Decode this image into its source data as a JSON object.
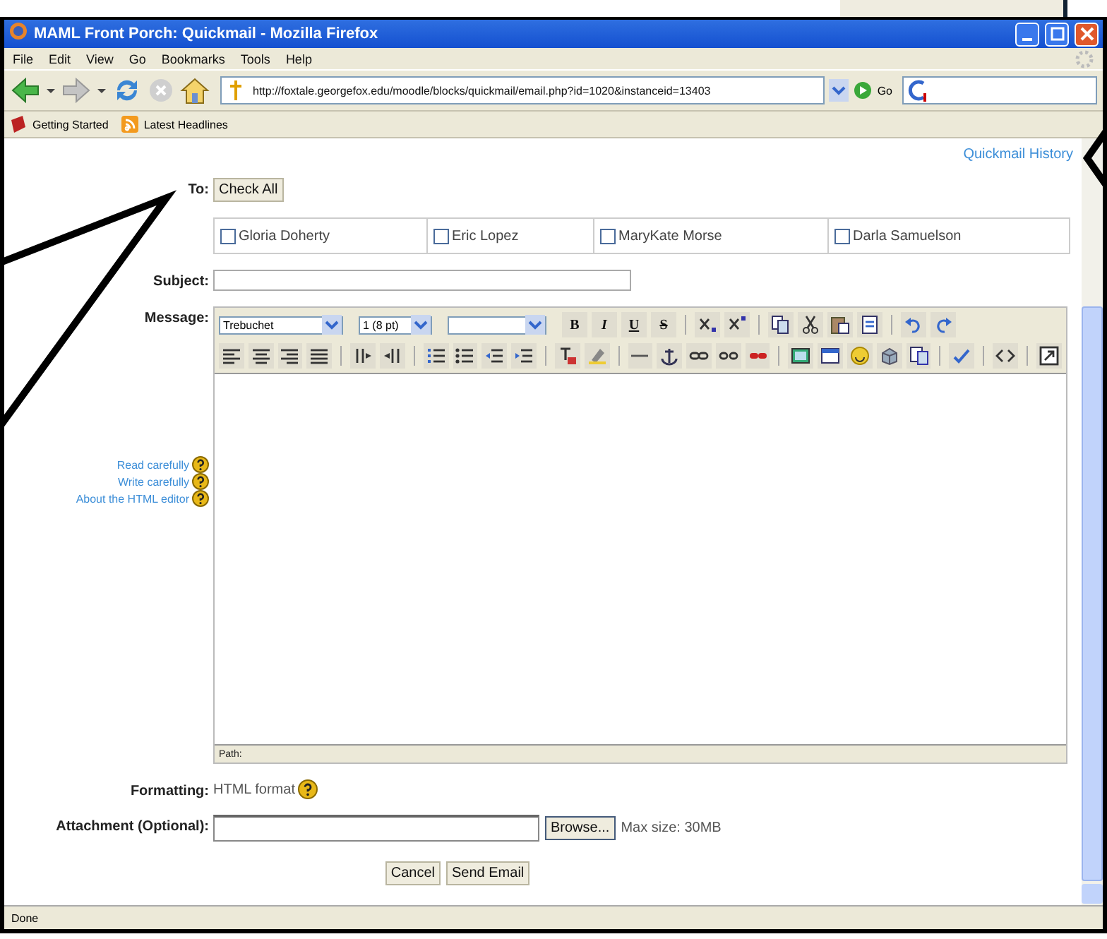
{
  "window": {
    "title": "MAML Front Porch: Quickmail - Mozilla Firefox"
  },
  "menu": [
    "File",
    "Edit",
    "View",
    "Go",
    "Bookmarks",
    "Tools",
    "Help"
  ],
  "address": "http://foxtale.georgefox.edu/moodle/blocks/quickmail/email.php?id=1020&instanceid=13403",
  "go": "Go",
  "bookmarks": [
    "Getting Started",
    "Latest Headlines"
  ],
  "history_link": "Quickmail History",
  "to_label": "To:",
  "check_all": "Check All",
  "recipients": [
    {
      "name": "Gloria Doherty",
      "checked": false
    },
    {
      "name": "Eric Lopez",
      "checked": false
    },
    {
      "name": "MaryKate Morse",
      "checked": false
    },
    {
      "name": "Darla Samuelson",
      "checked": false
    }
  ],
  "subject_label": "Subject:",
  "message_label": "Message:",
  "editor": {
    "font": "Trebuchet",
    "size": "1 (8 pt)",
    "format_buttons": [
      "B",
      "I",
      "U",
      "S"
    ],
    "path": "Path:"
  },
  "help_links": [
    "Read carefully",
    "Write carefully",
    "About the HTML editor"
  ],
  "formatting": {
    "label": "Formatting:",
    "value": "HTML format"
  },
  "attachment": {
    "label": "Attachment (Optional):",
    "browse": "Browse...",
    "max_size": "Max size: 30MB"
  },
  "buttons": [
    "Cancel",
    "Send Email"
  ],
  "status_bar": "Done"
}
